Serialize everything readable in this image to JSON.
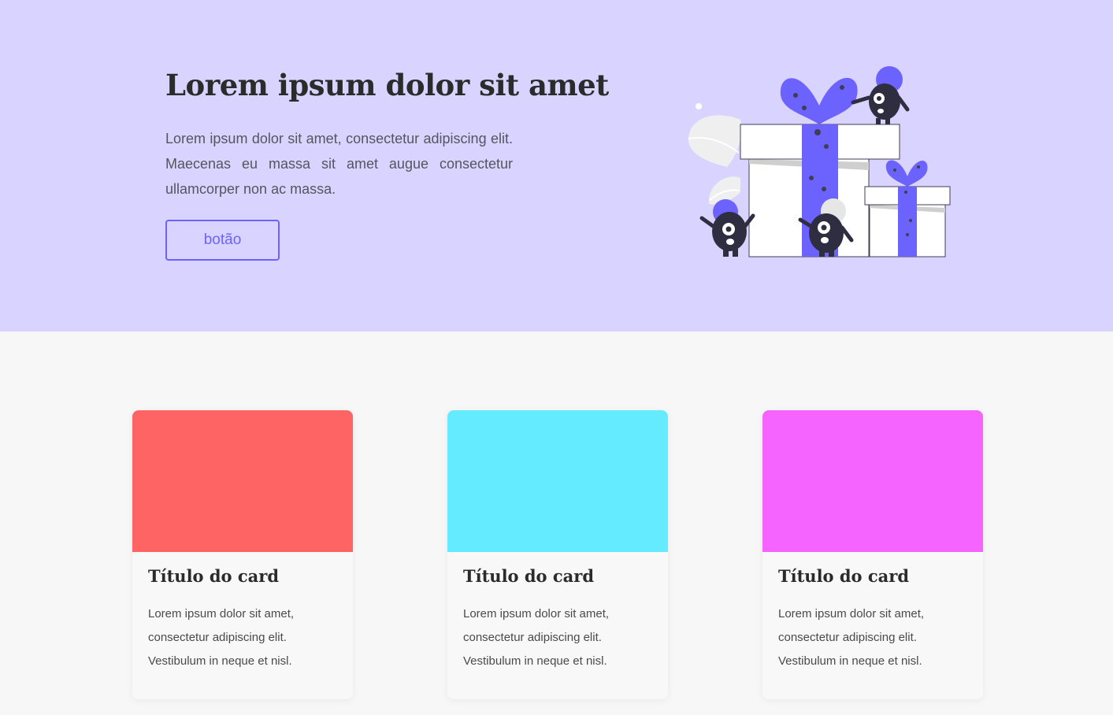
{
  "hero": {
    "title": "Lorem ipsum dolor sit amet",
    "text": "Lorem ipsum dolor sit amet, consectetur adipiscing elit. Maecenas eu massa sit amet augue consectetur ullamcorper non ac massa.",
    "button_label": "botão",
    "background": "#d8d4ff",
    "accent": "#6c63ff"
  },
  "cards": [
    {
      "title": "Título do card",
      "text": "Lorem ipsum dolor sit amet, consectetur adipiscing elit. Vestibulum in neque et nisl.",
      "color": "#ff6464"
    },
    {
      "title": "Título do card",
      "text": "Lorem ipsum dolor sit amet, consectetur adipiscing elit. Vestibulum in neque et nisl.",
      "color": "#64ebff"
    },
    {
      "title": "Título do card",
      "text": "Lorem ipsum dolor sit amet, consectetur adipiscing elit. Vestibulum in neque et nisl.",
      "color": "#f564ff"
    }
  ]
}
